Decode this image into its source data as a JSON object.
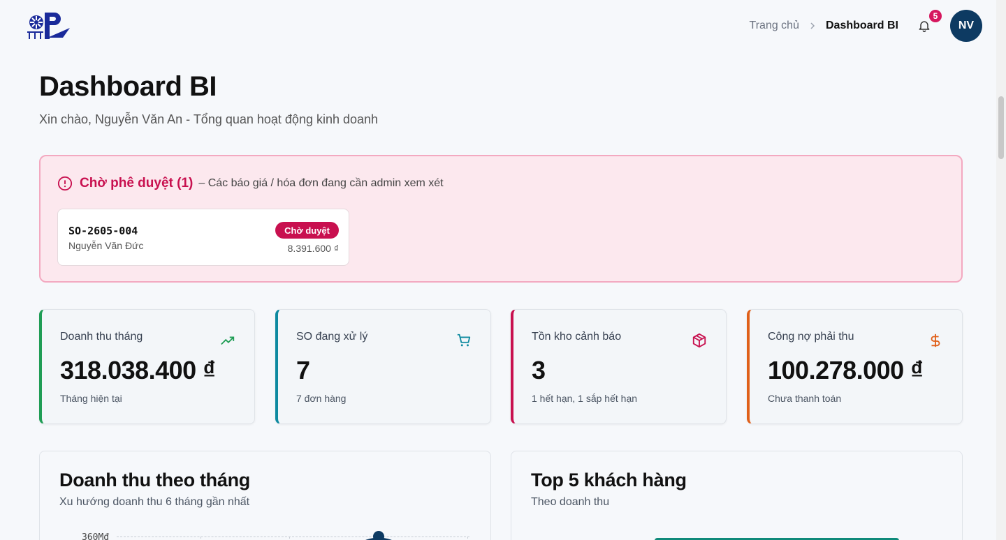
{
  "header": {
    "breadcrumb_home": "Trang chủ",
    "breadcrumb_current": "Dashboard BI",
    "notification_count": "5",
    "avatar_initials": "NV"
  },
  "page": {
    "title": "Dashboard BI",
    "subtitle": "Xin chào, Nguyễn Văn An - Tổng quan hoạt động kinh doanh"
  },
  "pending": {
    "title": "Chờ phê duyệt (1)",
    "description": "– Các báo giá / hóa đơn đang cần admin xem xét",
    "items": [
      {
        "code": "SO-2605-004",
        "customer": "Nguyễn Văn Đức",
        "status": "Chờ duyệt",
        "amount": "8.391.600 ₫"
      }
    ]
  },
  "stats": [
    {
      "label": "Doanh thu tháng",
      "value": "318.038.400 ₫",
      "sub": "Tháng hiện tại",
      "icon": "trending-up-icon",
      "color": "#1f9d55"
    },
    {
      "label": "SO đang xử lý",
      "value": "7",
      "sub": "7 đơn hàng",
      "icon": "cart-icon",
      "color": "#0e8aa0"
    },
    {
      "label": "Tồn kho cảnh báo",
      "value": "3",
      "sub": "1 hết hạn, 1 sắp hết hạn",
      "icon": "box-icon",
      "color": "#c8104f"
    },
    {
      "label": "Công nợ phải thu",
      "value": "100.278.000 ₫",
      "sub": "Chưa thanh toán",
      "icon": "dollar-icon",
      "color": "#e0601a"
    }
  ],
  "panels": {
    "revenue": {
      "title": "Doanh thu theo tháng",
      "subtitle": "Xu hướng doanh thu 6 tháng gần nhất",
      "y_tick": "360M₫"
    },
    "top_customers": {
      "title": "Top 5 khách hàng",
      "subtitle": "Theo doanh thu"
    }
  },
  "colors": {
    "accent": "#c8104f",
    "brand": "#0d3a62",
    "pending_bg": "#fce8ee"
  }
}
